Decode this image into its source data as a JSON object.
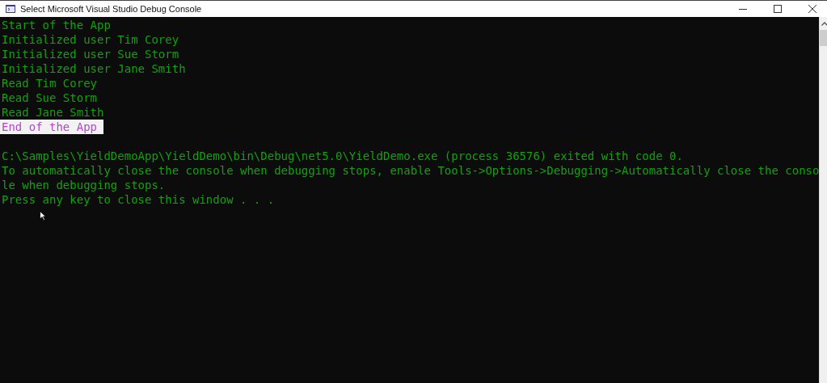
{
  "window": {
    "title": "Select Microsoft Visual Studio Debug Console"
  },
  "console": {
    "lines": [
      {
        "text": "Start of the App",
        "selected": false
      },
      {
        "text": "Initialized user Tim Corey",
        "selected": false
      },
      {
        "text": "Initialized user Sue Storm",
        "selected": false
      },
      {
        "text": "Initialized user Jane Smith",
        "selected": false
      },
      {
        "text": "Read Tim Corey",
        "selected": false
      },
      {
        "text": "Read Sue Storm",
        "selected": false
      },
      {
        "text": "Read Jane Smith",
        "selected": false
      },
      {
        "text": "End of the App ",
        "selected": true
      },
      {
        "text": "C:\\Samples\\YieldDemoApp\\YieldDemo\\bin\\Debug\\net5.0\\YieldDemo.exe (process 36576) exited with code 0.",
        "selected": false,
        "spaced": true
      },
      {
        "text": "To automatically close the console when debugging stops, enable Tools->Options->Debugging->Automatically close the conso",
        "selected": false
      },
      {
        "text": "le when debugging stops.",
        "selected": false
      },
      {
        "text": "Press any key to close this window . . .",
        "selected": false
      }
    ]
  }
}
